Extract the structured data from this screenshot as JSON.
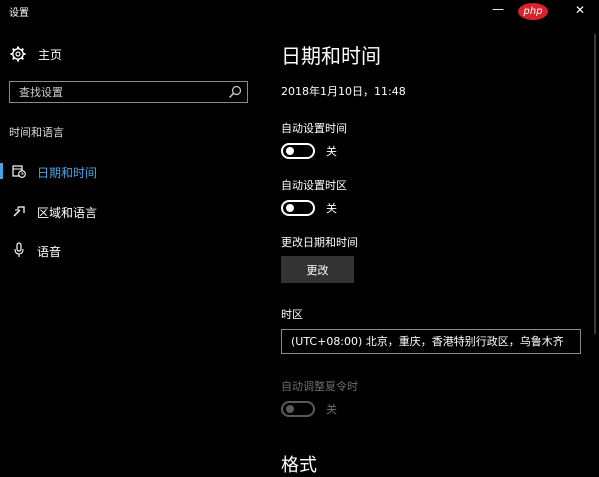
{
  "window": {
    "title": "设置",
    "minimize_label": "—",
    "close_label": "✕",
    "watermark": "php"
  },
  "sidebar": {
    "home_label": "主页",
    "search_placeholder": "查找设置",
    "section_heading": "时间和语言",
    "items": [
      {
        "label": "日期和时间",
        "icon": "calendar-clock-icon",
        "selected": true
      },
      {
        "label": "区域和语言",
        "icon": "region-language-icon",
        "selected": false
      },
      {
        "label": "语音",
        "icon": "microphone-icon",
        "selected": false
      }
    ]
  },
  "main": {
    "title": "日期和时间",
    "current_datetime": "2018年1月10日，11:48",
    "auto_time": {
      "label": "自动设置时间",
      "state": "关"
    },
    "auto_timezone": {
      "label": "自动设置时区",
      "state": "关"
    },
    "change_datetime": {
      "label": "更改日期和时间",
      "button": "更改"
    },
    "timezone": {
      "label": "时区",
      "value": "(UTC+08:00) 北京，重庆，香港特别行政区，乌鲁木齐"
    },
    "daylight_saving": {
      "label": "自动调整夏令时",
      "state": "关",
      "disabled": true
    },
    "format_heading": "格式"
  },
  "colors": {
    "background": "#000000",
    "accent": "#4aa3df",
    "button_bg": "#333333",
    "disabled_text": "#6e6e6e"
  }
}
